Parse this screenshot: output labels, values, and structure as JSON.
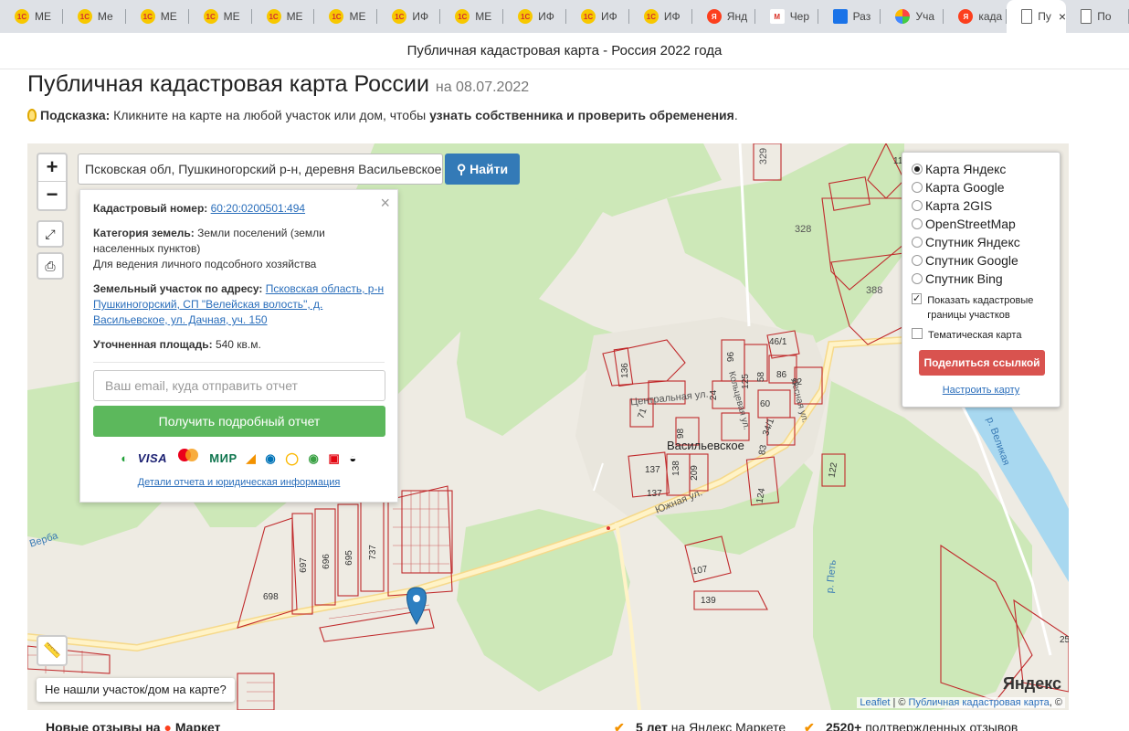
{
  "tabs": [
    {
      "icon": "1c-icon",
      "label": "МЕ"
    },
    {
      "icon": "1c-icon",
      "label": "Ме"
    },
    {
      "icon": "1c-icon",
      "label": "МЕ"
    },
    {
      "icon": "1c-icon",
      "label": "МЕ"
    },
    {
      "icon": "1c-icon",
      "label": "МЕ"
    },
    {
      "icon": "1c-icon",
      "label": "МЕ"
    },
    {
      "icon": "1c-icon",
      "label": "ИФ"
    },
    {
      "icon": "1c-icon",
      "label": "МЕ"
    },
    {
      "icon": "1c-icon",
      "label": "ИФ"
    },
    {
      "icon": "1c-icon",
      "label": "ИФ"
    },
    {
      "icon": "1c-icon",
      "label": "ИФ"
    },
    {
      "icon": "yandex-icon",
      "label": "Янд"
    },
    {
      "icon": "gmail-icon",
      "label": "Чер"
    },
    {
      "icon": "disk-icon",
      "label": "Раз"
    },
    {
      "icon": "apps-icon",
      "label": "Уча"
    },
    {
      "icon": "yandex-icon",
      "label": "када"
    },
    {
      "icon": "document-icon",
      "label": "Пу",
      "active": true
    },
    {
      "icon": "document-icon",
      "label": "По"
    }
  ],
  "site_title": "Публичная кадастровая карта - Россия 2022 года",
  "page_title": "Публичная кадастровая карта России",
  "page_date": "на 08.07.2022",
  "hint": {
    "label": "Подсказка:",
    "text": " Кликните на карте на любой участок или дом, чтобы ",
    "bold": "узнать собственника и проверить обременения",
    "end": "."
  },
  "search": {
    "value": "Псковская обл, Пушкиногорский р-н, деревня Васильевское",
    "button": "Найти"
  },
  "zoom": {
    "in": "+",
    "out": "−"
  },
  "popup": {
    "cad_label": "Кадастровый номер:",
    "cad_value": "60:20:0200501:494",
    "cat_label": "Категория земель:",
    "cat_value": "Земли поселений (земли населенных пунктов)",
    "cat_use": "Для ведения личного подсобного хозяйства",
    "addr_label": "Земельный участок по адресу:",
    "addr_value": "Псковская область, р-н Пушкиногорский, СП \"Велейская волость\", д. Васильевское, ул. Дачная, уч. 150",
    "area_label": "Уточненная площадь:",
    "area_value": "540 кв.м.",
    "email_placeholder": "Ваш email, куда отправить отчет",
    "get_button": "Получить подробный отчет",
    "payments": [
      "VISA",
      "МИР"
    ],
    "details_link": "Детали отчета и юридическая информация",
    "close": "×"
  },
  "layers": {
    "options": [
      {
        "label": "Карта Яндекс",
        "selected": true
      },
      {
        "label": "Карта Google",
        "selected": false
      },
      {
        "label": "Карта 2GIS",
        "selected": false
      },
      {
        "label": "OpenStreetMap",
        "selected": false
      },
      {
        "label": "Спутник Яндекс",
        "selected": false
      },
      {
        "label": "Спутник Google",
        "selected": false
      },
      {
        "label": "Спутник Bing",
        "selected": false
      }
    ],
    "show_borders": "Показать кадастровые границы участков",
    "thematic": "Тематическая карта",
    "share": "Поделиться ссылкой",
    "configure": "Настроить карту"
  },
  "map_labels": {
    "village": "Васильевское",
    "streets": [
      "Центральная ул.",
      "Южная ул.",
      "Кольцевая ул.",
      "Лесная ул."
    ],
    "rivers": [
      "р. Великая",
      "р. Петь",
      "Верба"
    ],
    "parcels": [
      "329",
      "328",
      "388",
      "46/1",
      "96",
      "125",
      "86",
      "62",
      "58",
      "60",
      "136",
      "71",
      "98",
      "137",
      "138",
      "209",
      "137",
      "124",
      "83",
      "122",
      "34/1",
      "24",
      "107",
      "139",
      "698",
      "697",
      "696",
      "695",
      "737",
      "11",
      "25"
    ]
  },
  "not_found": "Не нашли участок/дом на карте?",
  "attribution": {
    "leaflet": "Leaflet",
    "sep": " | © ",
    "source": "Публичная кадастровая карта",
    "tail": ", ©"
  },
  "yandex_logo": "Яндекс",
  "footer": {
    "reviews": "Новые отзывы на",
    "market": "Маркет",
    "years": "5 лет",
    "years_tail": "на Яндекс Маркете",
    "count": "2520+",
    "count_tail": "подтвержденных отзывов"
  }
}
